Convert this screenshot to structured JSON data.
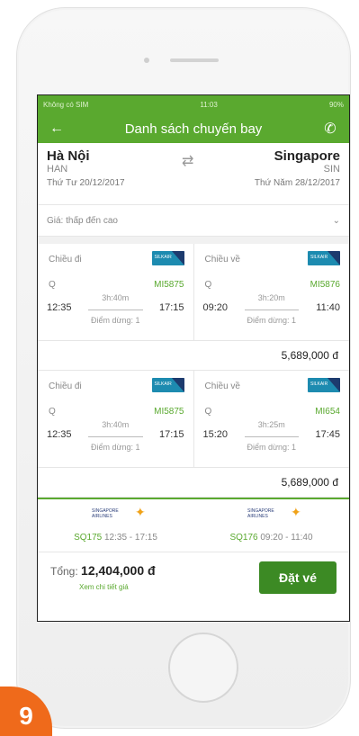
{
  "status_bar": {
    "carrier": "Không có SIM",
    "time": "11:03",
    "battery": "90%"
  },
  "nav": {
    "title": "Danh sách chuyến bay"
  },
  "route": {
    "from_city": "Hà Nội",
    "from_code": "HAN",
    "from_date": "Thứ Tư 20/12/2017",
    "to_city": "Singapore",
    "to_code": "SIN",
    "to_date": "Thứ Năm 28/12/2017"
  },
  "sort": {
    "label": "Giá: thấp đến cao"
  },
  "options": [
    {
      "outbound": {
        "label": "Chiều đi",
        "airline": "SILKAIR",
        "class": "Q",
        "flight": "MI5875",
        "duration": "3h:40m",
        "depart": "12:35",
        "arrive": "17:15",
        "stops": "Điểm dừng: 1"
      },
      "inbound": {
        "label": "Chiều về",
        "airline": "SILKAIR",
        "class": "Q",
        "flight": "MI5876",
        "duration": "3h:20m",
        "depart": "09:20",
        "arrive": "11:40",
        "stops": "Điểm dừng: 1"
      },
      "price": "5,689,000 đ"
    },
    {
      "outbound": {
        "label": "Chiều đi",
        "airline": "SILKAIR",
        "class": "Q",
        "flight": "MI5875",
        "duration": "3h:40m",
        "depart": "12:35",
        "arrive": "17:15",
        "stops": "Điểm dừng: 1"
      },
      "inbound": {
        "label": "Chiều về",
        "airline": "SILKAIR",
        "class": "Q",
        "flight": "MI654",
        "duration": "3h:25m",
        "depart": "15:20",
        "arrive": "17:45",
        "stops": "Điểm dừng: 1"
      },
      "price": "5,689,000 đ"
    }
  ],
  "summary": [
    {
      "airline": "SINGAPORE AIRLINES",
      "flight": "SQ175",
      "times": "12:35 - 17:15"
    },
    {
      "airline": "SINGAPORE AIRLINES",
      "flight": "SQ176",
      "times": "09:20 - 11:40"
    }
  ],
  "footer": {
    "total_label": "Tổng:",
    "total_value": "12,404,000 đ",
    "detail_link": "Xem chi tiết giá",
    "book_button": "Đặt vé"
  },
  "badge": {
    "number": "9"
  },
  "colors": {
    "primary": "#5aa92f",
    "button": "#3c8a24",
    "badge": "#ef6a1b"
  }
}
